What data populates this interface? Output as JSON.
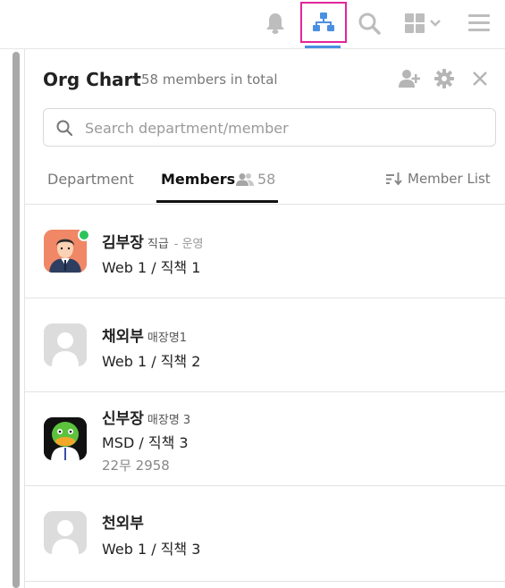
{
  "topbar": {
    "icons": [
      "bell-icon",
      "org-chart-icon",
      "search-icon",
      "apps-grid-icon",
      "menu-icon"
    ],
    "accent": "#4a90e2",
    "highlight": "#e2269a"
  },
  "panel": {
    "title": "Org Chart",
    "subtitle": "58 members in total",
    "search_placeholder": "Search department/member",
    "tabs": {
      "department": "Department",
      "members": "Members",
      "members_count": "58",
      "member_list": "Member List"
    }
  },
  "members": [
    {
      "name": "김부장",
      "position": "직급",
      "dept": "- 운영",
      "line2": "Web 1 / 직책 1",
      "online": true
    },
    {
      "name": "채외부",
      "position": "매장명1",
      "dept": "",
      "line2": "Web 1 / 직책 2"
    },
    {
      "name": "신부장",
      "position": "매장명 3",
      "dept": "",
      "line2": "MSD / 직책 3",
      "line3": "22무 2958"
    },
    {
      "name": "천외부",
      "position": "",
      "dept": "",
      "line2": "Web 1 / 직책 3"
    }
  ],
  "colors": {
    "online": "#2bc45a",
    "placeholder_avatar": "#dcdcdc"
  }
}
